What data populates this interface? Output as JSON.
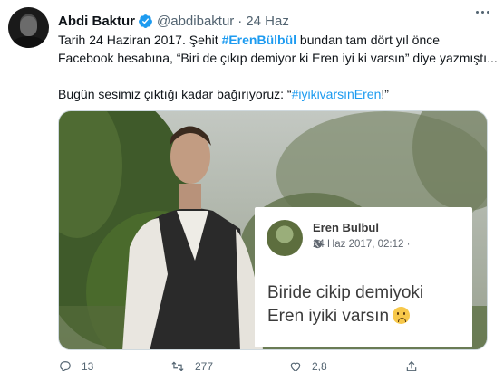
{
  "tweet": {
    "author_name": "Abdi Baktur",
    "handle": "@abdibaktur",
    "separator": "·",
    "date": "24 Haz",
    "text": {
      "line1_prefix": "Tarih 24 Haziran 2017. Şehit ",
      "line1_mention": "#ErenBülbül",
      "line1_suffix": " bundan tam dört yıl önce",
      "line2": "Facebook hesabına, “Biri de çıkıp demiyor ki Eren iyi ki varsın” diye yazmıştı...",
      "line3_prefix": "Bugün sesimiz çıktığı kadar bağırıyoruz: “",
      "line3_hashtag": "#iyikivarsınEren",
      "line3_suffix": "!”"
    },
    "actions": {
      "reply_count": "13",
      "retweet_count": "277",
      "like_count": "2,8",
      "share_count": ""
    }
  },
  "facebook_post": {
    "name": "Eren Bulbul",
    "timestamp": "24 Haz 2017, 02:12 ·",
    "text_line1": "Biride cikip demiyoki",
    "text_line2": "Eren iyiki varsın"
  },
  "icons": {
    "verified": "verified-badge-icon",
    "more": "more-options-icon",
    "reply": "reply-icon",
    "retweet": "retweet-icon",
    "like": "like-icon",
    "share": "share-icon",
    "globe": "globe-icon",
    "emoji": "frowning-face-emoji-icon"
  },
  "colors": {
    "accent": "#1d9bf0",
    "text": "#0f1419",
    "secondary": "#536471"
  }
}
